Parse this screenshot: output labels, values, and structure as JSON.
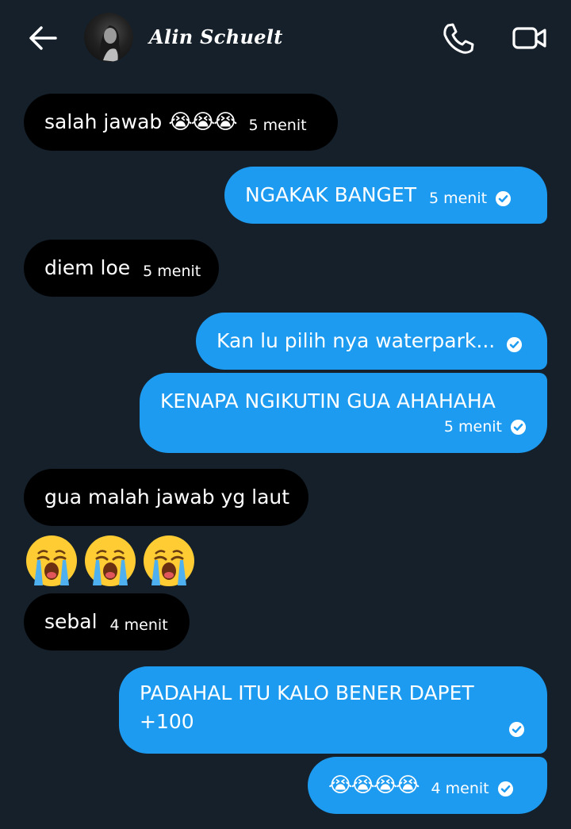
{
  "header": {
    "contact_name": "Alin Schuelt",
    "icons": {
      "back": "arrow-left-icon",
      "call": "phone-icon",
      "video": "video-camera-icon"
    }
  },
  "colors": {
    "background": "#15202b",
    "incoming": "#000000",
    "outgoing": "#1d9bf0"
  },
  "messages": [
    {
      "dir": "in",
      "text": "salah jawab",
      "emoji": "😭😭😭",
      "time": "5 menit"
    },
    {
      "dir": "out",
      "text": "NGAKAK BANGET",
      "time": "5 menit",
      "seen": true
    },
    {
      "dir": "in",
      "text": "diem loe",
      "time": "5 menit"
    },
    {
      "dir": "out",
      "text": "Kan lu pilih nya waterpark...",
      "seen": true
    },
    {
      "dir": "out",
      "text": "KENAPA NGIKUTIN GUA AHAHAHA",
      "time": "5 menit",
      "seen": true
    },
    {
      "dir": "in",
      "text": "gua malah jawab yg laut"
    },
    {
      "dir": "in",
      "emoji_only": "😭😭😭"
    },
    {
      "dir": "in",
      "text": "sebal",
      "time": "4 menit"
    },
    {
      "dir": "out",
      "text": "PADAHAL ITU KALO BENER DAPET",
      "text2": "+100",
      "seen": true
    },
    {
      "dir": "out",
      "emoji": "😭😭😭😭",
      "time": "4 menit",
      "seen": true
    }
  ]
}
